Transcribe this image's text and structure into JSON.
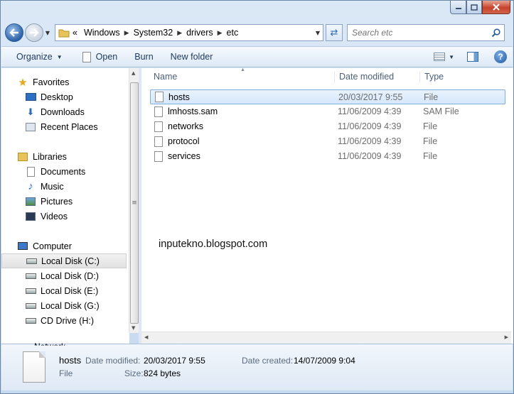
{
  "window": {
    "caption": {
      "minimize_icon": "minimize-icon",
      "maximize_icon": "maximize-icon",
      "close_icon": "close-icon"
    }
  },
  "address": {
    "overflow": "«",
    "crumbs": [
      "Windows",
      "System32",
      "drivers",
      "etc"
    ]
  },
  "search": {
    "placeholder": "Search etc"
  },
  "toolbar": {
    "organize": "Organize",
    "open": "Open",
    "burn": "Burn",
    "new_folder": "New folder"
  },
  "nav": {
    "favorites": "Favorites",
    "desktop": "Desktop",
    "downloads": "Downloads",
    "recent": "Recent Places",
    "libraries": "Libraries",
    "documents": "Documents",
    "music": "Music",
    "pictures": "Pictures",
    "videos": "Videos",
    "computer": "Computer",
    "disk_c": "Local Disk (C:)",
    "disk_d": "Local Disk (D:)",
    "disk_e": "Local Disk (E:)",
    "disk_g": "Local Disk (G:)",
    "cd_h": "CD Drive (H:)",
    "network_partial": "Network"
  },
  "columns": {
    "name": "Name",
    "date": "Date modified",
    "type": "Type"
  },
  "files": [
    {
      "name": "hosts",
      "date": "20/03/2017 9:55",
      "type": "File"
    },
    {
      "name": "lmhosts.sam",
      "date": "11/06/2009 4:39",
      "type": "SAM File"
    },
    {
      "name": "networks",
      "date": "11/06/2009 4:39",
      "type": "File"
    },
    {
      "name": "protocol",
      "date": "11/06/2009 4:39",
      "type": "File"
    },
    {
      "name": "services",
      "date": "11/06/2009 4:39",
      "type": "File"
    }
  ],
  "watermark": "inputekno.blogspot.com",
  "details": {
    "name": "hosts",
    "kind": "File",
    "date_modified_label": "Date modified:",
    "date_modified": "20/03/2017 9:55",
    "date_created_label": "Date created:",
    "date_created": "14/07/2009 9:04",
    "size_label": "Size:",
    "size": "824 bytes"
  },
  "colors": {
    "selection": "#d6e8fb",
    "selection_border": "#84acdd",
    "close_button": "#c6432c",
    "toolbar_text": "#1e395b"
  }
}
